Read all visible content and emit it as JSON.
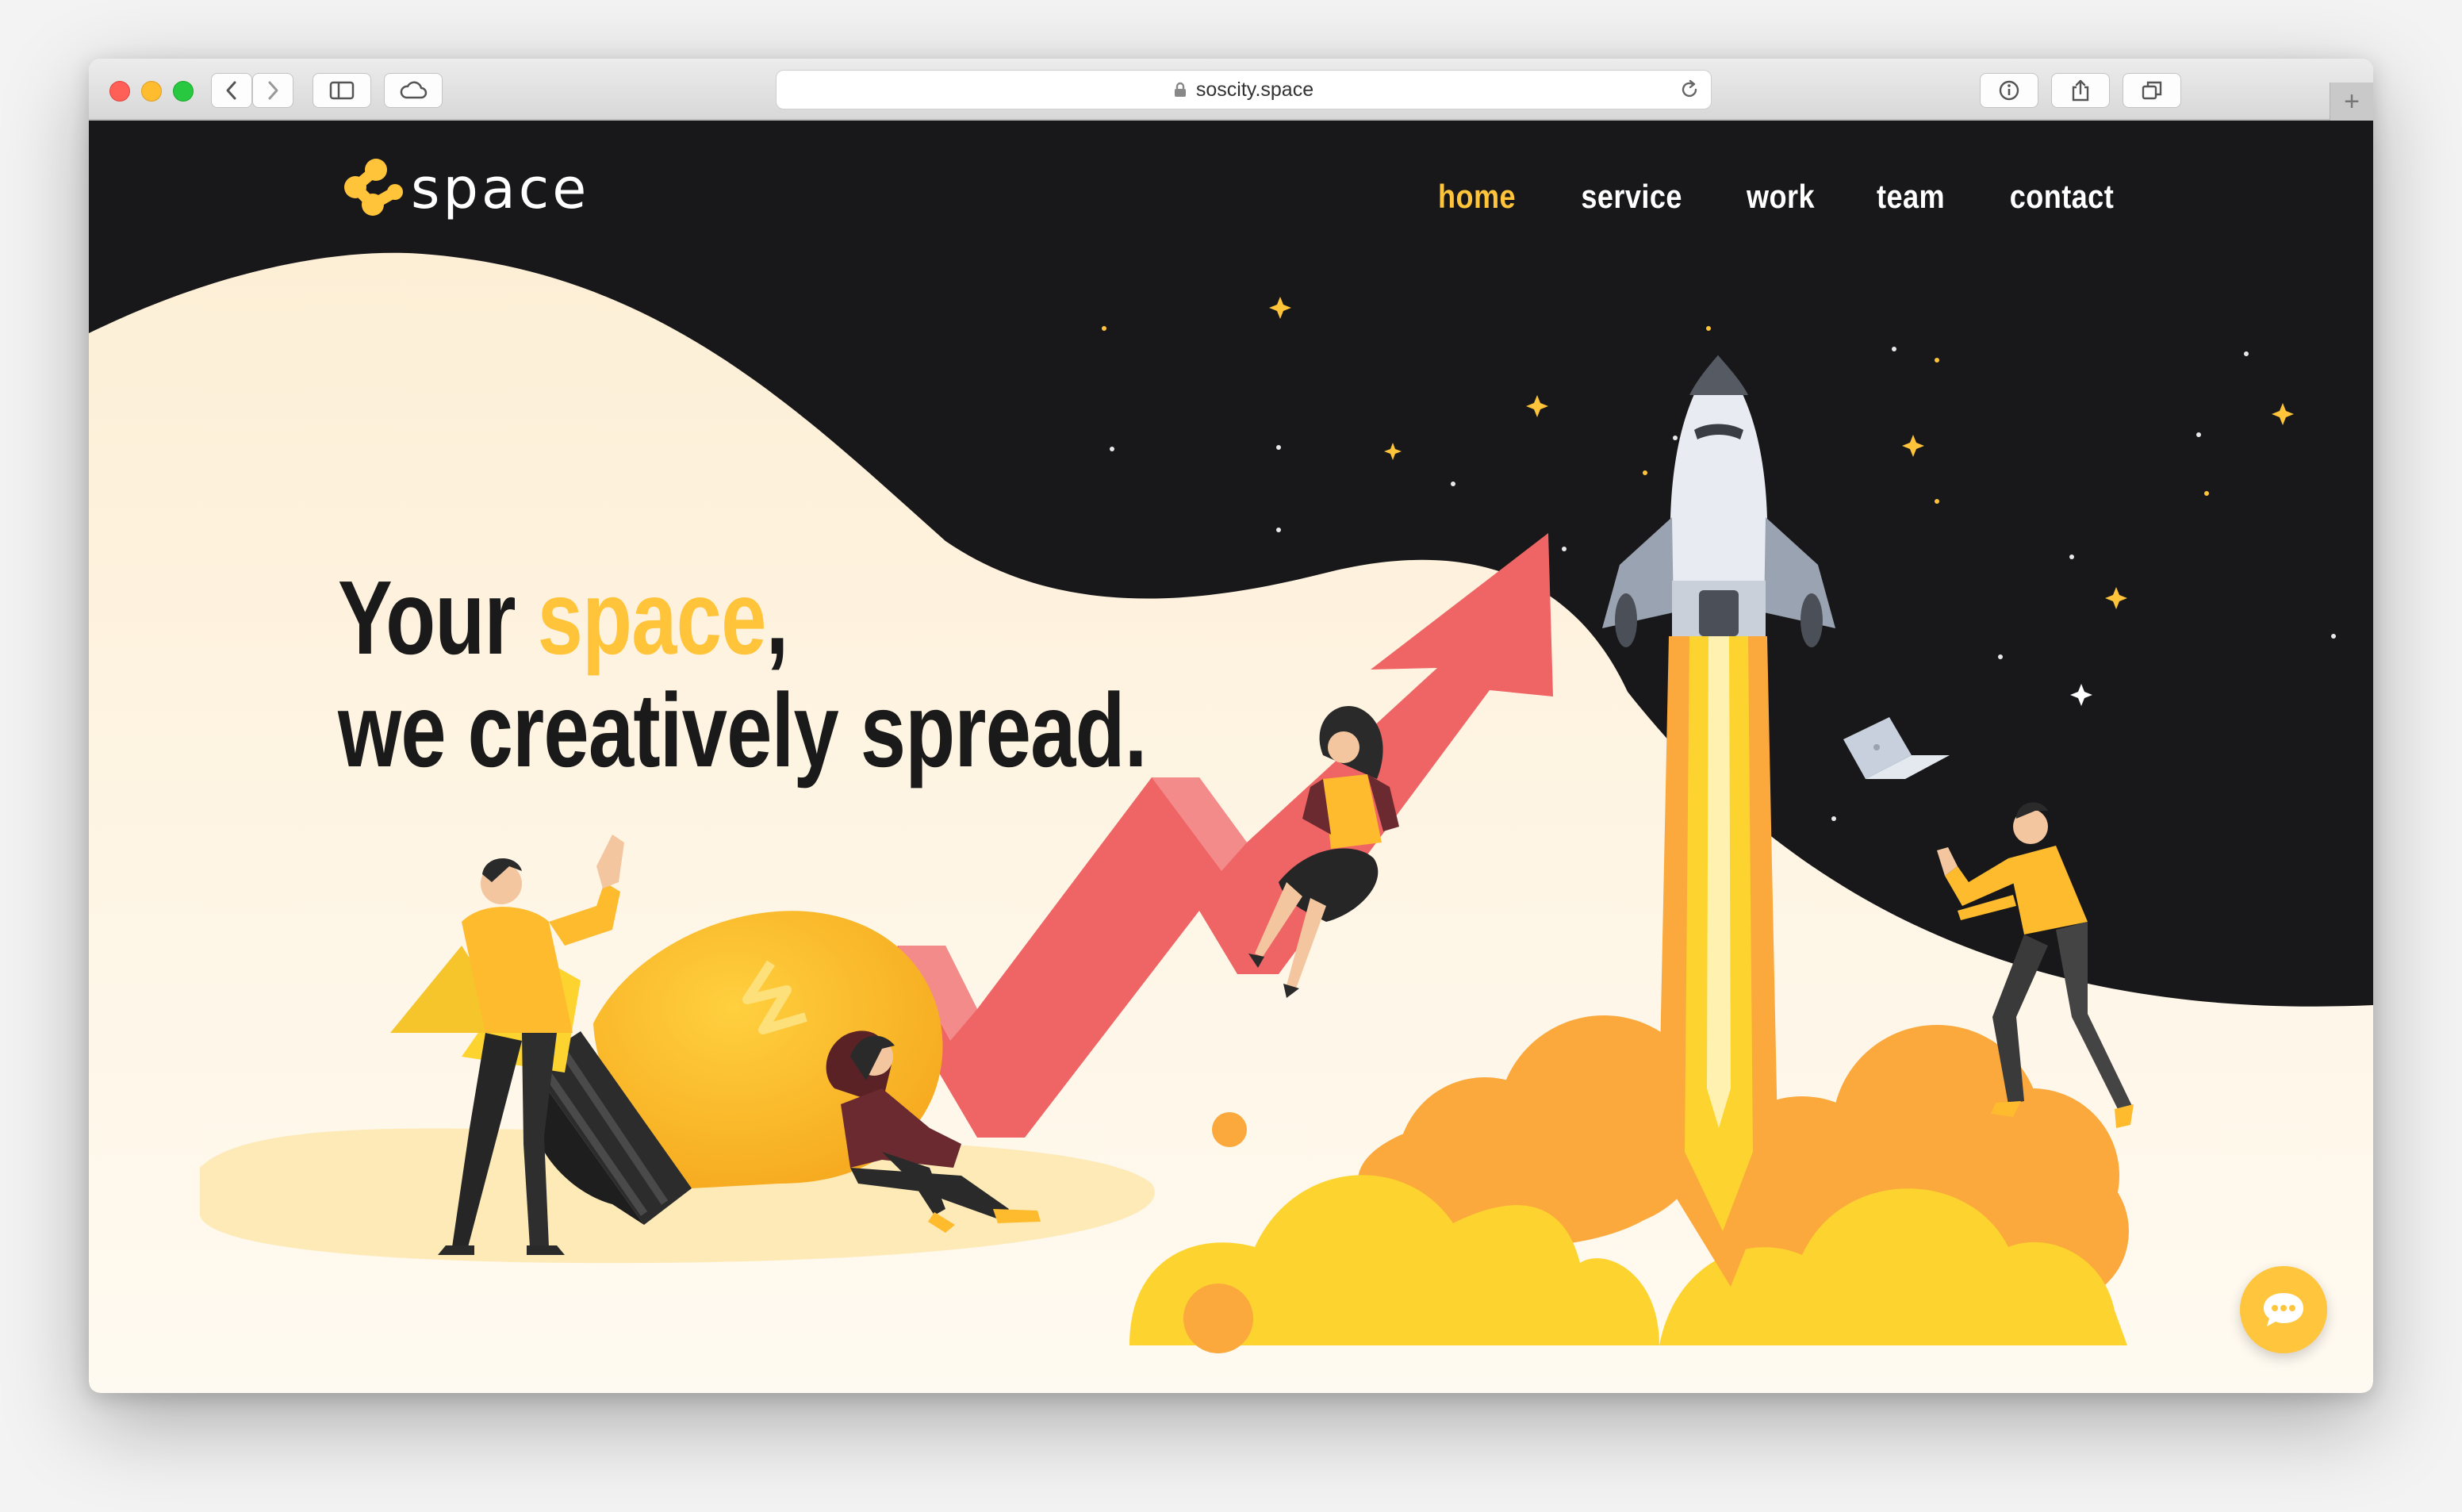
{
  "browser": {
    "url": "soscity.space",
    "new_tab_symbol": "+"
  },
  "site": {
    "logo_text": "space",
    "nav": [
      {
        "label": "home",
        "active": true
      },
      {
        "label": "service",
        "active": false
      },
      {
        "label": "work",
        "active": false
      },
      {
        "label": "team",
        "active": false
      },
      {
        "label": "contact",
        "active": false
      }
    ],
    "hero": {
      "line1_before": "Your ",
      "line1_highlight": "space",
      "line1_after": ",",
      "line2": "we creatively spread."
    }
  },
  "colors": {
    "accent": "#ffc43a",
    "background_dark": "#18181a",
    "background_light": "#fdf1dc",
    "arrow": "#ef6464",
    "cloud_orange": "#fba83d",
    "cloud_yellow": "#fdd42f"
  },
  "icons": [
    "back-icon",
    "forward-icon",
    "sidebar-icon",
    "cloud-icon",
    "lock-icon",
    "reload-icon",
    "info-icon",
    "share-icon",
    "tabs-icon",
    "chat-icon"
  ]
}
